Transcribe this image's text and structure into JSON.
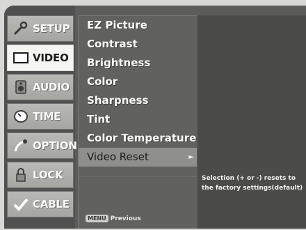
{
  "tabs": [
    {
      "label": "SETUP",
      "icon": "wrench-icon",
      "active": false
    },
    {
      "label": "VIDEO",
      "icon": "monitor-icon",
      "active": true
    },
    {
      "label": "AUDIO",
      "icon": "speaker-icon",
      "active": false
    },
    {
      "label": "TIME",
      "icon": "clock-icon",
      "active": false
    },
    {
      "label": "OPTION",
      "icon": "gear-icon",
      "active": false
    },
    {
      "label": "LOCK",
      "icon": "lock-icon",
      "active": false
    },
    {
      "label": "CABLE",
      "icon": "checkmark-icon",
      "active": false
    }
  ],
  "menu": {
    "items": [
      "EZ Picture",
      "Contrast",
      "Brightness",
      "Color",
      "Sharpness",
      "Tint",
      "Color Temperature",
      "Video Reset"
    ],
    "selected_index": 7,
    "selected_arrow": "►"
  },
  "footer": {
    "button": "MENU",
    "label": "Previous"
  },
  "description": {
    "text": "Selection (+ or -) resets to the factory settings(default)"
  }
}
